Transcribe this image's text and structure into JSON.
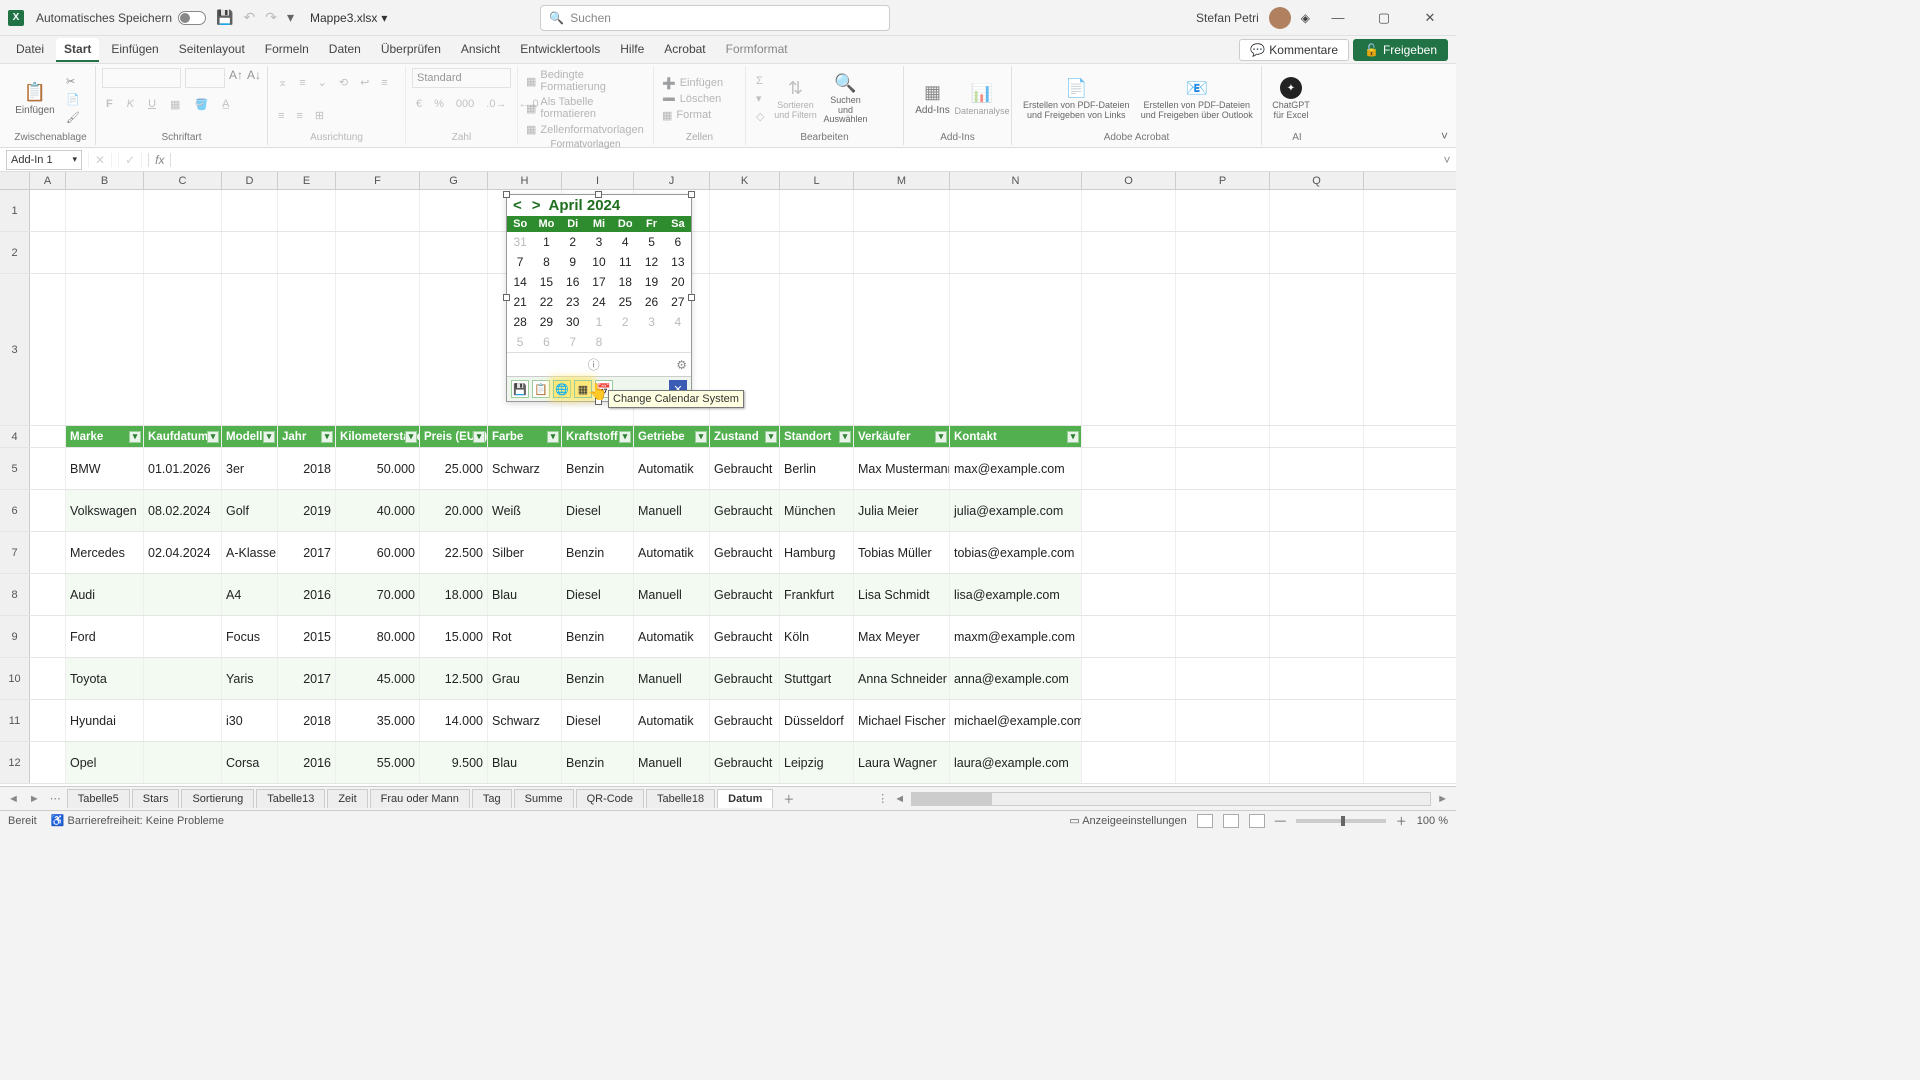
{
  "title": {
    "autosave": "Automatisches Speichern",
    "docname": "Mappe3.xlsx",
    "search_placeholder": "Suchen",
    "username": "Stefan Petri"
  },
  "menu": {
    "items": [
      "Datei",
      "Start",
      "Einfügen",
      "Seitenlayout",
      "Formeln",
      "Daten",
      "Überprüfen",
      "Ansicht",
      "Entwicklertools",
      "Hilfe",
      "Acrobat",
      "Formformat"
    ],
    "active": 1,
    "comments": "Kommentare",
    "share": "Freigeben"
  },
  "ribbon": {
    "paste": "Einfügen",
    "clipboard": "Zwischenablage",
    "font_group": "Schriftart",
    "align_group": "Ausrichtung",
    "number_group": "Zahl",
    "number_format": "Standard",
    "styles_group": "Formatvorlagen",
    "cond": "Bedingte Formatierung",
    "astable": "Als Tabelle formatieren",
    "cellstyles": "Zellenformatvorlagen",
    "cells_group": "Zellen",
    "insert": "Einfügen",
    "delete": "Löschen",
    "format": "Format",
    "edit_group": "Bearbeiten",
    "sortfilter": "Sortieren und Filtern",
    "findsel": "Suchen und Auswählen",
    "addins_group": "Add-Ins",
    "addins": "Add-Ins",
    "dataanalysis": "Datenanalyse",
    "acrobat_group": "Adobe Acrobat",
    "pdf1": "Erstellen von PDF-Dateien und Freigeben von Links",
    "pdf2": "Erstellen von PDF-Dateien und Freigeben über Outlook",
    "ai_group": "AI",
    "gpt": "ChatGPT für Excel"
  },
  "fbar": {
    "name": "Add-In 1"
  },
  "columns": [
    "A",
    "B",
    "C",
    "D",
    "E",
    "F",
    "G",
    "H",
    "I",
    "J",
    "K",
    "L",
    "M",
    "N",
    "O",
    "P",
    "Q"
  ],
  "table": {
    "headers": [
      "Marke",
      "Kaufdatum",
      "Modell",
      "Jahr",
      "Kilometerstand",
      "Preis (EUR)",
      "Farbe",
      "Kraftstoff",
      "Getriebe",
      "Zustand",
      "Standort",
      "Verkäufer",
      "Kontakt"
    ],
    "rows": [
      [
        "BMW",
        "01.01.2026",
        "3er",
        "2018",
        "50.000",
        "25.000",
        "Schwarz",
        "Benzin",
        "Automatik",
        "Gebraucht",
        "Berlin",
        "Max Mustermann",
        "max@example.com"
      ],
      [
        "Volkswagen",
        "08.02.2024",
        "Golf",
        "2019",
        "40.000",
        "20.000",
        "Weiß",
        "Diesel",
        "Manuell",
        "Gebraucht",
        "München",
        "Julia Meier",
        "julia@example.com"
      ],
      [
        "Mercedes",
        "02.04.2024",
        "A-Klasse",
        "2017",
        "60.000",
        "22.500",
        "Silber",
        "Benzin",
        "Automatik",
        "Gebraucht",
        "Hamburg",
        "Tobias Müller",
        "tobias@example.com"
      ],
      [
        "Audi",
        "",
        "A4",
        "2016",
        "70.000",
        "18.000",
        "Blau",
        "Diesel",
        "Manuell",
        "Gebraucht",
        "Frankfurt",
        "Lisa Schmidt",
        "lisa@example.com"
      ],
      [
        "Ford",
        "",
        "Focus",
        "2015",
        "80.000",
        "15.000",
        "Rot",
        "Benzin",
        "Automatik",
        "Gebraucht",
        "Köln",
        "Max Meyer",
        "maxm@example.com"
      ],
      [
        "Toyota",
        "",
        "Yaris",
        "2017",
        "45.000",
        "12.500",
        "Grau",
        "Benzin",
        "Manuell",
        "Gebraucht",
        "Stuttgart",
        "Anna Schneider",
        "anna@example.com"
      ],
      [
        "Hyundai",
        "",
        "i30",
        "2018",
        "35.000",
        "14.000",
        "Schwarz",
        "Diesel",
        "Automatik",
        "Gebraucht",
        "Düsseldorf",
        "Michael Fischer",
        "michael@example.com"
      ],
      [
        "Opel",
        "",
        "Corsa",
        "2016",
        "55.000",
        "9.500",
        "Blau",
        "Benzin",
        "Manuell",
        "Gebraucht",
        "Leipzig",
        "Laura Wagner",
        "laura@example.com"
      ]
    ]
  },
  "calendar": {
    "title": "April 2024",
    "prev": "<",
    "next": ">",
    "dow": [
      "So",
      "Mo",
      "Di",
      "Mi",
      "Do",
      "Fr",
      "Sa"
    ],
    "weeks": [
      [
        {
          "d": "31",
          "o": true
        },
        {
          "d": "1"
        },
        {
          "d": "2"
        },
        {
          "d": "3"
        },
        {
          "d": "4"
        },
        {
          "d": "5"
        },
        {
          "d": "6"
        }
      ],
      [
        {
          "d": "7"
        },
        {
          "d": "8"
        },
        {
          "d": "9"
        },
        {
          "d": "10"
        },
        {
          "d": "11"
        },
        {
          "d": "12"
        },
        {
          "d": "13"
        }
      ],
      [
        {
          "d": "14"
        },
        {
          "d": "15"
        },
        {
          "d": "16"
        },
        {
          "d": "17"
        },
        {
          "d": "18"
        },
        {
          "d": "19"
        },
        {
          "d": "20"
        }
      ],
      [
        {
          "d": "21"
        },
        {
          "d": "22"
        },
        {
          "d": "23"
        },
        {
          "d": "24"
        },
        {
          "d": "25"
        },
        {
          "d": "26"
        },
        {
          "d": "27"
        }
      ],
      [
        {
          "d": "28"
        },
        {
          "d": "29"
        },
        {
          "d": "30"
        },
        {
          "d": "1",
          "o": true
        },
        {
          "d": "2",
          "o": true
        },
        {
          "d": "3",
          "o": true
        },
        {
          "d": "4",
          "o": true
        }
      ],
      [
        {
          "d": "5",
          "o": true
        },
        {
          "d": "6",
          "o": true
        },
        {
          "d": "7",
          "o": true
        },
        {
          "d": "8",
          "o": true
        },
        {
          "d": "",
          "o": true
        },
        {
          "d": "",
          "o": true
        },
        {
          "d": "",
          "o": true
        }
      ]
    ],
    "tooltip": "Change Calendar System"
  },
  "sheets": {
    "tabs": [
      "Tabelle5",
      "Stars",
      "Sortierung",
      "Tabelle13",
      "Zeit",
      "Frau oder Mann",
      "Tag",
      "Summe",
      "QR-Code",
      "Tabelle18",
      "Datum"
    ],
    "active": 10
  },
  "status": {
    "ready": "Bereit",
    "acc": "Barrierefreiheit: Keine Probleme",
    "display": "Anzeigeeinstellungen",
    "zoom": "100 %"
  }
}
